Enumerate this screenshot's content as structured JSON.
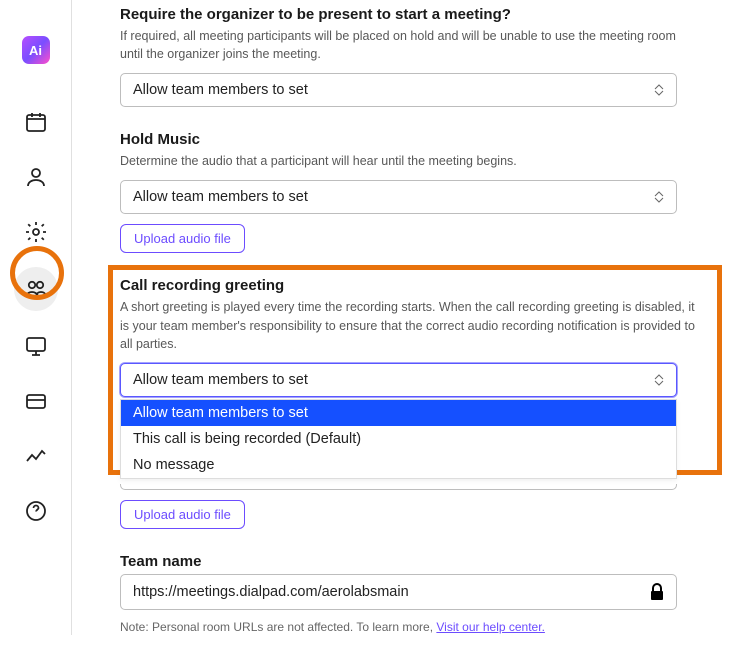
{
  "sidebar": {
    "logo": "Ai"
  },
  "organizer": {
    "title": "Require the organizer to be present to start a meeting?",
    "desc": "If required, all meeting participants will be placed on hold and will be unable to use the meeting room until the organizer joins the meeting.",
    "select": "Allow team members to set"
  },
  "hold_music": {
    "title": "Hold Music",
    "desc": "Determine the audio that a participant will hear until the meeting begins.",
    "select": "Allow team members to set",
    "upload": "Upload audio file"
  },
  "greeting": {
    "title": "Call recording greeting",
    "desc": "A short greeting is played every time the recording starts. When the call recording greeting is disabled, it is your team member's responsibility to ensure that the correct audio recording notification is provided to all parties.",
    "select": "Allow team members to set",
    "options": [
      "Allow team members to set",
      "This call is being recorded (Default)",
      "No message"
    ],
    "upload": "Upload audio file"
  },
  "team_name": {
    "title": "Team name",
    "value": "https://meetings.dialpad.com/aerolabsmain",
    "note_prefix": "Note: Personal room URLs are not affected. To learn more, ",
    "note_link": "Visit our help center."
  }
}
